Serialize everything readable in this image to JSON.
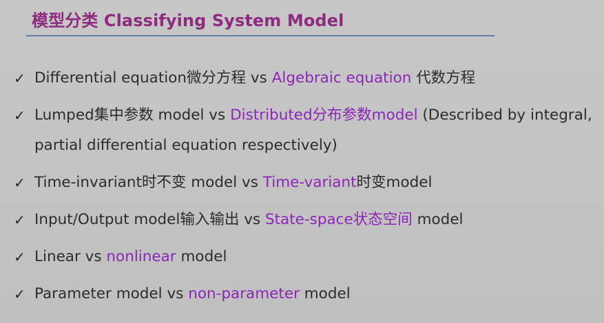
{
  "slide": {
    "title": "模型分类 Classifying System Model",
    "check_glyph": "✓",
    "highlight_color": "#8d25b8",
    "title_color": "#8e2a7f",
    "items": [
      {
        "a": "Differential equation微分方程 vs ",
        "b": "Algebraic equation",
        "c": " 代数方程"
      },
      {
        "a": "Lumped集中参数 model vs ",
        "b": "Distributed分布参数model",
        "c": " (Described by  integral, partial differential equation respectively)"
      },
      {
        "a": "Time-invariant时不变 model vs ",
        "b": "Time-variant",
        "c": "时变model"
      },
      {
        "a": "Input/Output model输入输出 vs ",
        "b": "State-space状态空间",
        "c": " model"
      },
      {
        "a": "Linear vs ",
        "b": "nonlinear",
        "c": " model"
      },
      {
        "a": "Parameter model vs ",
        "b": "non-parameter",
        "c": " model"
      }
    ]
  }
}
